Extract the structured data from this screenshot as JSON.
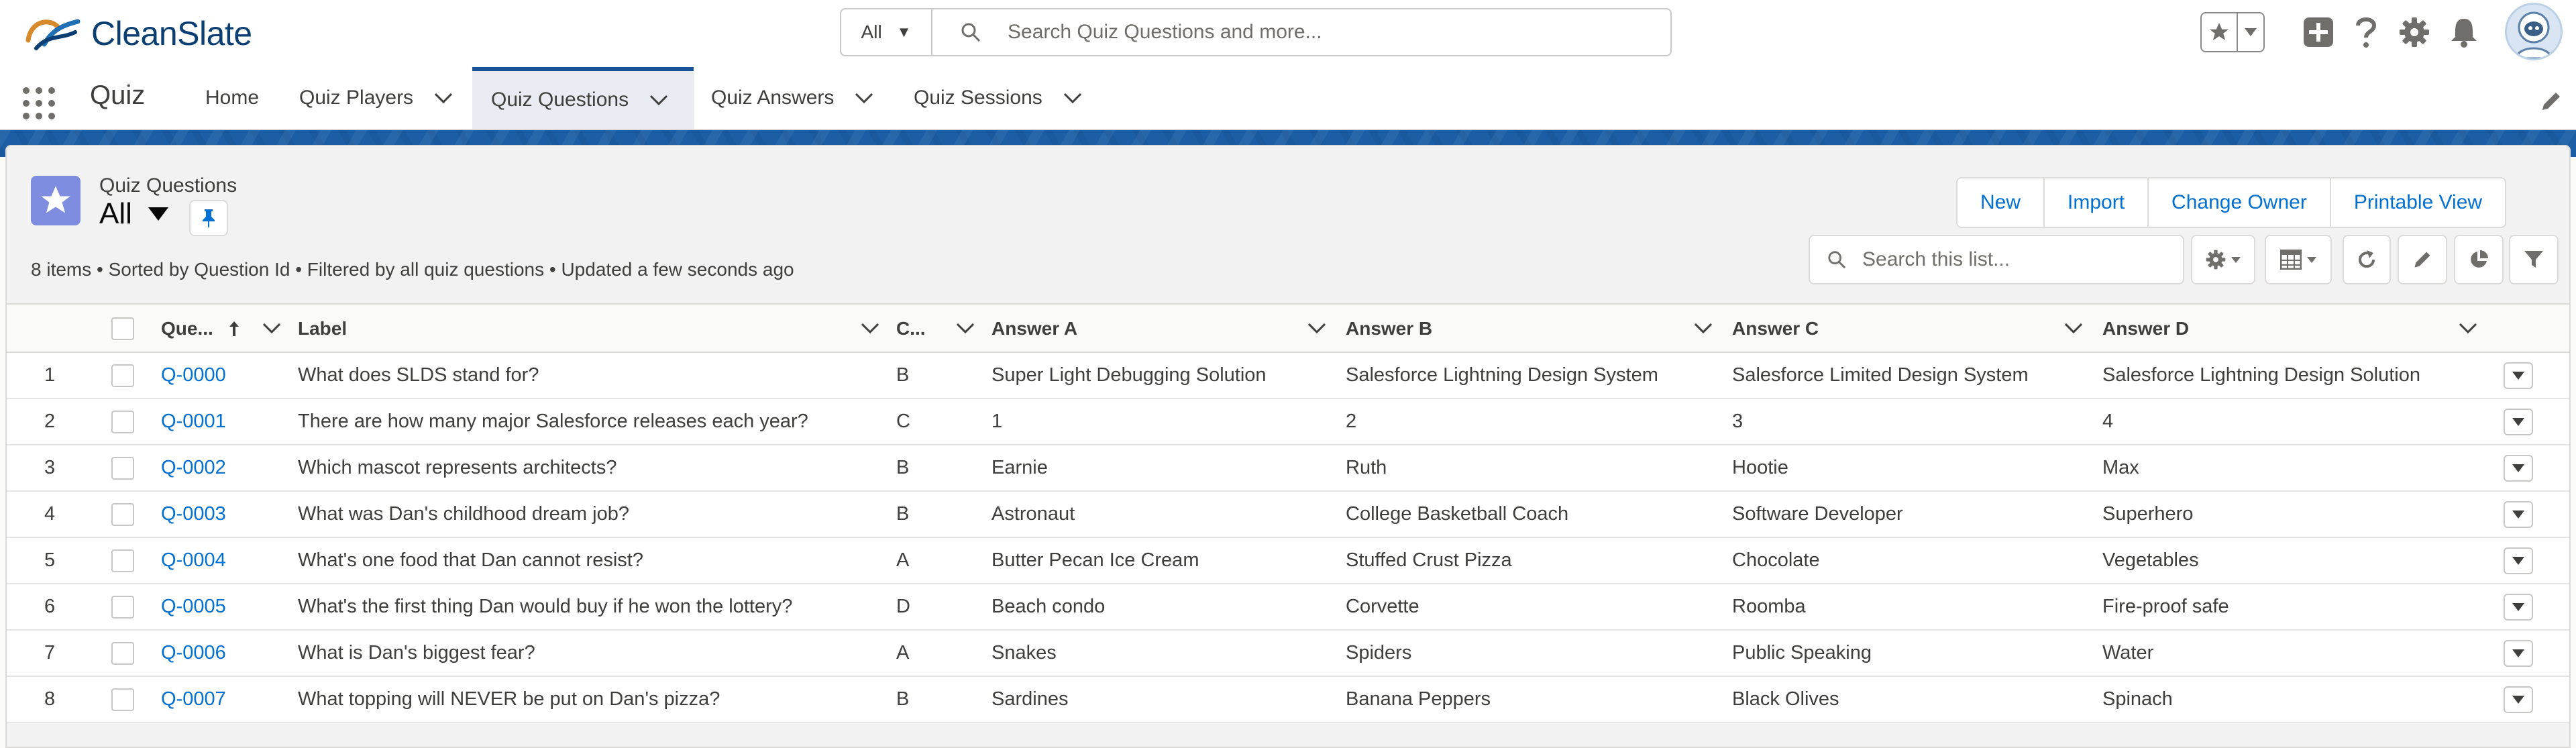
{
  "brand": {
    "name": "CleanSlate"
  },
  "global_search": {
    "scope": "All",
    "placeholder": "Search Quiz Questions and more..."
  },
  "header_icons": [
    "favorites-star-icon",
    "add-icon",
    "help-icon",
    "setup-gear-icon",
    "notifications-bell-icon",
    "avatar"
  ],
  "app": {
    "name": "Quiz"
  },
  "nav_tabs": [
    {
      "label": "Home",
      "has_menu": false,
      "active": false
    },
    {
      "label": "Quiz Players",
      "has_menu": true,
      "active": false
    },
    {
      "label": "Quiz Questions",
      "has_menu": true,
      "active": true
    },
    {
      "label": "Quiz Answers",
      "has_menu": true,
      "active": false
    },
    {
      "label": "Quiz Sessions",
      "has_menu": true,
      "active": false
    }
  ],
  "list_view": {
    "object_label": "Quiz Questions",
    "view_name": "All",
    "meta": "8 items • Sorted by Question Id • Filtered by all quiz questions • Updated a few seconds ago",
    "actions": [
      "New",
      "Import",
      "Change Owner",
      "Printable View"
    ],
    "search_placeholder": "Search this list...",
    "tools": [
      "settings-gear-icon",
      "table-display-icon",
      "refresh-icon",
      "edit-pencil-icon",
      "chart-icon",
      "filter-icon"
    ]
  },
  "table": {
    "columns": [
      "Que...",
      "Label",
      "C...",
      "Answer A",
      "Answer B",
      "Answer C",
      "Answer D"
    ],
    "sorted_column": "Que...",
    "rows": [
      {
        "n": "1",
        "id": "Q-0000",
        "label": "What does SLDS stand for?",
        "correct": "B",
        "a": "Super Light Debugging Solution",
        "b": "Salesforce Lightning Design System",
        "c": "Salesforce Limited Design System",
        "d": "Salesforce Lightning Design Solution"
      },
      {
        "n": "2",
        "id": "Q-0001",
        "label": "There are how many major Salesforce releases each year?",
        "correct": "C",
        "a": "1",
        "b": "2",
        "c": "3",
        "d": "4"
      },
      {
        "n": "3",
        "id": "Q-0002",
        "label": "Which mascot represents architects?",
        "correct": "B",
        "a": "Earnie",
        "b": "Ruth",
        "c": "Hootie",
        "d": "Max"
      },
      {
        "n": "4",
        "id": "Q-0003",
        "label": "What was Dan's childhood dream job?",
        "correct": "B",
        "a": "Astronaut",
        "b": "College Basketball Coach",
        "c": "Software Developer",
        "d": "Superhero"
      },
      {
        "n": "5",
        "id": "Q-0004",
        "label": "What's one food that Dan cannot resist?",
        "correct": "A",
        "a": "Butter Pecan Ice Cream",
        "b": "Stuffed Crust Pizza",
        "c": "Chocolate",
        "d": "Vegetables"
      },
      {
        "n": "6",
        "id": "Q-0005",
        "label": "What's the first thing Dan would buy if he won the lottery?",
        "correct": "D",
        "a": "Beach condo",
        "b": "Corvette",
        "c": "Roomba",
        "d": "Fire-proof safe"
      },
      {
        "n": "7",
        "id": "Q-0006",
        "label": "What is Dan's biggest fear?",
        "correct": "A",
        "a": "Snakes",
        "b": "Spiders",
        "c": "Public Speaking",
        "d": "Water"
      },
      {
        "n": "8",
        "id": "Q-0007",
        "label": "What topping will NEVER be put on Dan's pizza?",
        "correct": "B",
        "a": "Sardines",
        "b": "Banana Peppers",
        "c": "Black Olives",
        "d": "Spinach"
      }
    ]
  },
  "colors": {
    "brand_blue": "#1b5297",
    "link": "#0070d2",
    "list_icon": "#7f8de1"
  }
}
